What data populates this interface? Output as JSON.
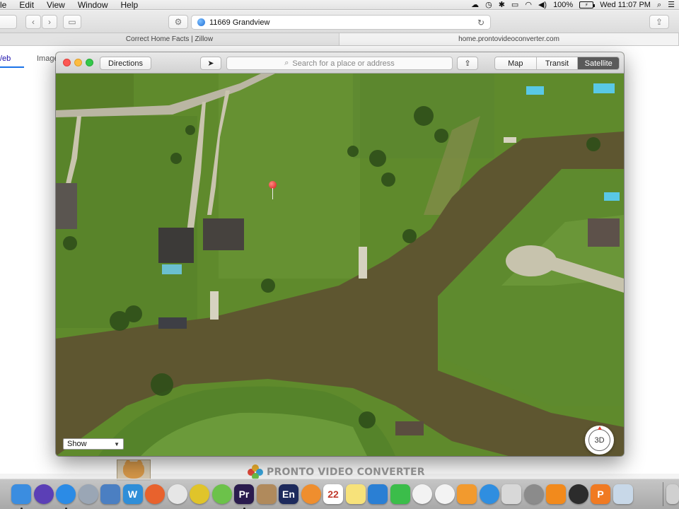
{
  "menubar": {
    "items": [
      "le",
      "Edit",
      "View",
      "Window",
      "Help"
    ],
    "battery_percent": "100%",
    "clock": "Wed 11:07 PM"
  },
  "safari": {
    "address": "11669 Grandview",
    "tabs": [
      "Correct Home Facts | Zillow",
      "home.prontovideoconverter.com"
    ],
    "page_left_text": "/eb",
    "page_images_text": "Image"
  },
  "maps": {
    "directions_label": "Directions",
    "search_placeholder": "Search for a place or address",
    "view_modes": [
      "Map",
      "Transit",
      "Satellite"
    ],
    "selected_view": "Satellite",
    "compass_label": "3D",
    "zoom_out": "−",
    "zoom_in": "+",
    "show_select": "Show",
    "colors": {
      "water": "#5e5630",
      "grass": "#5f8a2c",
      "grass_light": "#79a23b",
      "pin": "#d4161a"
    }
  },
  "background": {
    "watermark": "PRONTO VIDEO CONVERTER"
  },
  "dock": {
    "icons": [
      {
        "name": "finder-icon",
        "label": "",
        "color": "#3b8de0"
      },
      {
        "name": "siri-icon",
        "label": "",
        "color": "#5b3fb6"
      },
      {
        "name": "safari-icon",
        "label": "",
        "color": "#2b8be6"
      },
      {
        "name": "launchpad-icon",
        "label": "",
        "color": "#9aa6b5"
      },
      {
        "name": "mail-stamp-icon",
        "label": "",
        "color": "#4b7fc2"
      },
      {
        "name": "word-w-icon",
        "label": "W",
        "color": "#2f8ed8"
      },
      {
        "name": "firefox-icon",
        "label": "",
        "color": "#e8622d"
      },
      {
        "name": "chrome-icon",
        "label": "",
        "color": "#e6e6e6"
      },
      {
        "name": "cyberduck-icon",
        "label": "",
        "color": "#e0c42a"
      },
      {
        "name": "dreamweaver-icon",
        "label": "",
        "color": "#6cc24a"
      },
      {
        "name": "premiere-icon",
        "label": "Pr",
        "color": "#2a1b4e"
      },
      {
        "name": "contacts-icon",
        "label": "",
        "color": "#b08a5c"
      },
      {
        "name": "encore-icon",
        "label": "En",
        "color": "#1d2a5c"
      },
      {
        "name": "app-orange-icon",
        "label": "",
        "color": "#ef8e2e"
      },
      {
        "name": "calendar-icon",
        "label": "22",
        "color": "#ffffff"
      },
      {
        "name": "notes-icon",
        "label": "",
        "color": "#f7e27a"
      },
      {
        "name": "screen-share-icon",
        "label": "",
        "color": "#2a7fd4"
      },
      {
        "name": "facetime-icon",
        "label": "",
        "color": "#3bbd4a"
      },
      {
        "name": "photos-icon",
        "label": "",
        "color": "#f2f2f2"
      },
      {
        "name": "itunes-icon",
        "label": "",
        "color": "#f3f3f3"
      },
      {
        "name": "ibooks-icon",
        "label": "",
        "color": "#f29a2e"
      },
      {
        "name": "app-store-icon",
        "label": "",
        "color": "#2f8ee0"
      },
      {
        "name": "preview-icon",
        "label": "",
        "color": "#d8d8d8"
      },
      {
        "name": "system-preferences-icon",
        "label": "",
        "color": "#8b8b8b"
      },
      {
        "name": "vlc-cone-icon",
        "label": "",
        "color": "#f28a1c"
      },
      {
        "name": "obs-icon",
        "label": "",
        "color": "#2c2c2c"
      },
      {
        "name": "pronto-p-icon",
        "label": "P",
        "color": "#f07a22"
      },
      {
        "name": "preview-photos-icon",
        "label": "",
        "color": "#c8d8e8"
      },
      {
        "name": "trash-icon",
        "label": "",
        "color": "#d0d0d0"
      }
    ]
  }
}
